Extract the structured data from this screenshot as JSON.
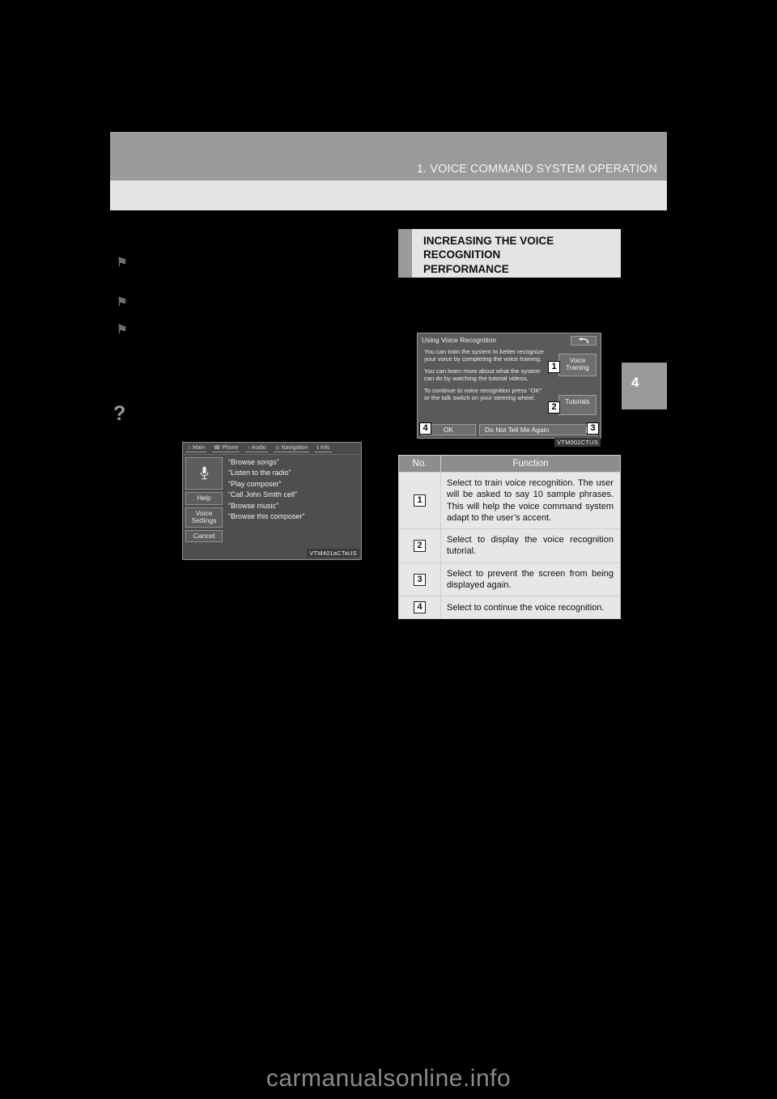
{
  "header": {
    "title": "1. VOICE COMMAND SYSTEM OPERATION"
  },
  "chapter_tab": {
    "number": "4"
  },
  "left_column": {
    "note": "body text redacted",
    "markers": [
      {
        "glyph": "⚑",
        "size": "small"
      },
      {
        "glyph": "⚑",
        "size": "small"
      },
      {
        "glyph": "⚑",
        "size": "small"
      },
      {
        "glyph": "?",
        "size": "large"
      }
    ]
  },
  "figure_voice_list": {
    "code": "VTM401aCTaUS",
    "nav_tabs": [
      {
        "icon": "home-icon",
        "glyph": "⌂",
        "label": "Main"
      },
      {
        "icon": "phone-icon",
        "glyph": "☎",
        "label": "Phone"
      },
      {
        "icon": "music-note-icon",
        "glyph": "♪",
        "label": "Audio"
      },
      {
        "icon": "compass-icon",
        "glyph": "◎",
        "label": "Navigation"
      },
      {
        "icon": "info-icon",
        "glyph": "ℹ",
        "label": "Info"
      }
    ],
    "mic_icon": "microphone-icon",
    "buttons": [
      {
        "label": "Help"
      },
      {
        "label": "Voice\nSettings"
      },
      {
        "label": "Cancel"
      }
    ],
    "button_help": "Help",
    "button_voice_settings_line1": "Voice",
    "button_voice_settings_line2": "Settings",
    "button_cancel": "Cancel",
    "commands": [
      "“Browse songs”",
      "“Listen to the radio”",
      "“Play composer”",
      "“Call John Smith cell”",
      "“Browse music”",
      "“Browse this composer”"
    ]
  },
  "heading": {
    "line1": "INCREASING THE VOICE",
    "line2": "RECOGNITION",
    "line3": "PERFORMANCE"
  },
  "figure_using_voice_recognition": {
    "code": "VTM002CTUS",
    "title": "Using Voice Recognition",
    "back_icon": "back-arrow-icon",
    "back_glyph": "↶",
    "paragraphs": [
      "You can train the system to better recognize your voice by completing the voice training.",
      "You can learn more about what the system can do by watching the tutorial videos.",
      "To continue to voice recognition press “OK” or the talk switch on your steering wheel."
    ],
    "voice_training_line1": "Voice",
    "voice_training_line2": "Training",
    "tutorials_label": "Tutorials",
    "ok_label": "OK",
    "do_not_tell_label": "Do Not Tell Me Again",
    "callouts": [
      {
        "number": "1"
      },
      {
        "number": "2"
      },
      {
        "number": "3"
      },
      {
        "number": "4"
      }
    ]
  },
  "function_table": {
    "columns": [
      "No.",
      "Function"
    ],
    "rows": [
      {
        "no": "1",
        "function": "Select to train voice recognition. The user will be asked to say 10 sample phrases. This will help the voice command system adapt to the user’s accent."
      },
      {
        "no": "2",
        "function": "Select to display the voice recognition tutorial."
      },
      {
        "no": "3",
        "function": "Select to prevent the screen from being displayed again."
      },
      {
        "no": "4",
        "function": "Select to continue the voice recognition."
      }
    ]
  },
  "watermark": {
    "text": "carmanualsonline.info"
  }
}
